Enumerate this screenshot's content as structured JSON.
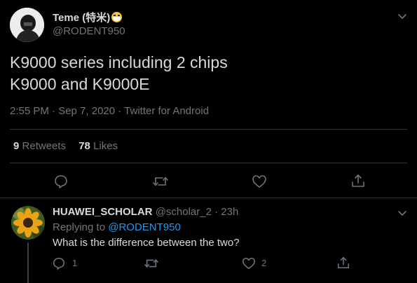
{
  "tweet": {
    "author_name": "Teme (特米)",
    "author_handle": "@RODENT950",
    "text_line1": "K9000 series including 2 chips",
    "text_line2": "K9000 and K9000E",
    "meta": "2:55 PM · Sep 7, 2020 · Twitter for Android",
    "retweets_count": "9",
    "retweets_label": "Retweets",
    "likes_count": "78",
    "likes_label": "Likes"
  },
  "reply": {
    "author_name": "HUAWEI_SCHOLAR",
    "author_handle": "@scholar_2",
    "time": "· 23h",
    "replying_to_label": "Replying to",
    "replying_to_handle": "@RODENT950",
    "text": "What is the difference between the two?",
    "reply_count": "1",
    "like_count": "2"
  },
  "icons": {
    "chevron": "chevron-down-icon",
    "reply": "reply-icon",
    "retweet": "retweet-icon",
    "like": "heart-icon",
    "share": "share-icon"
  },
  "colors": {
    "background": "#000000",
    "text": "#d9d9d9",
    "muted": "#6e767d",
    "link": "#1d9bf0",
    "divider": "#2f3336"
  }
}
